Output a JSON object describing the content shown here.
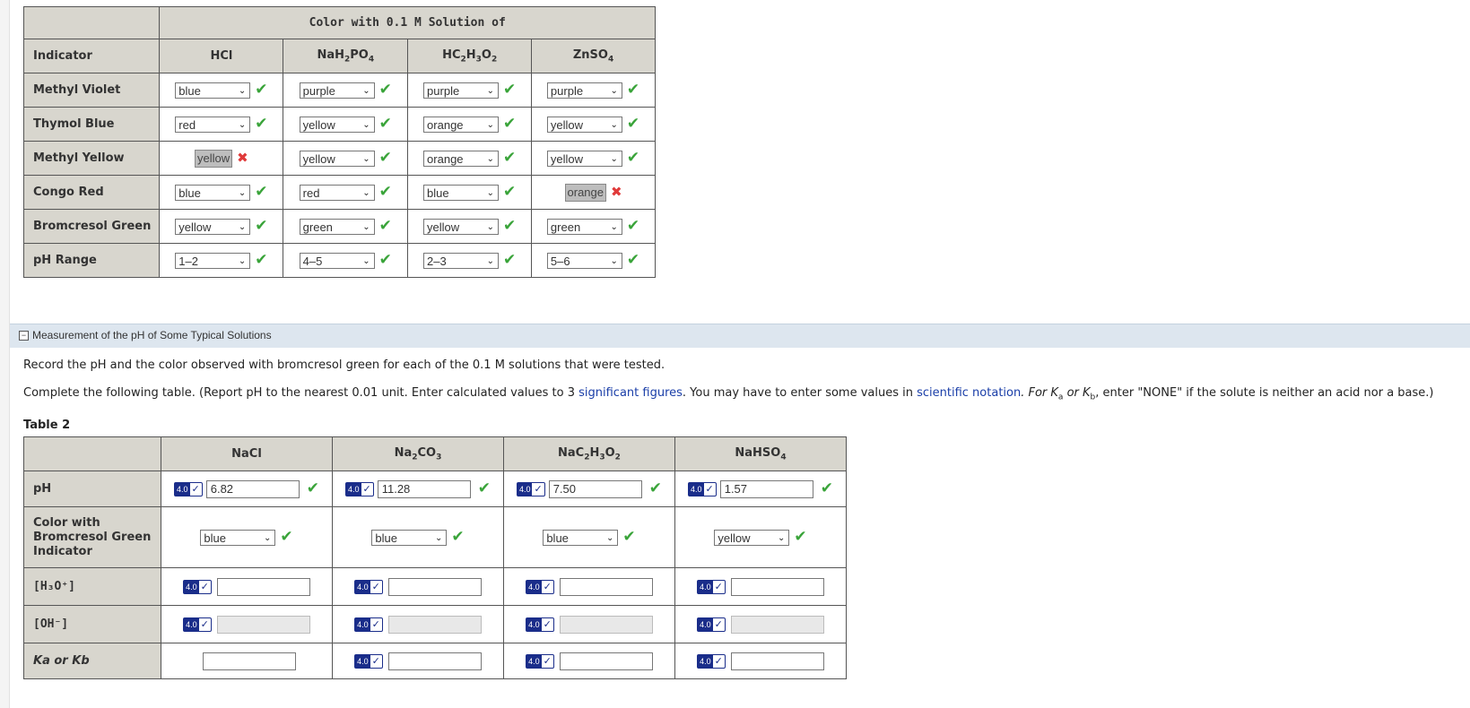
{
  "table1": {
    "header_title": "Color with 0.1 M Solution of",
    "indicator_label": "Indicator",
    "columns": [
      {
        "base": "HCl"
      },
      {
        "base": "NaH",
        "sub1": "2",
        "mid": "PO",
        "sub2": "4"
      },
      {
        "base": "HC",
        "sub1": "2",
        "mid": "H",
        "sub2": "3",
        "end": "O",
        "sub3": "2"
      },
      {
        "base": "ZnSO",
        "sub1": "4"
      }
    ],
    "rows": [
      {
        "label": "Methyl Violet",
        "cells": [
          {
            "value": "blue",
            "status": "correct",
            "type": "select"
          },
          {
            "value": "purple",
            "status": "correct",
            "type": "select"
          },
          {
            "value": "purple",
            "status": "correct",
            "type": "select"
          },
          {
            "value": "purple",
            "status": "correct",
            "type": "select"
          }
        ]
      },
      {
        "label": "Thymol Blue",
        "cells": [
          {
            "value": "red",
            "status": "correct",
            "type": "select"
          },
          {
            "value": "yellow",
            "status": "correct",
            "type": "select"
          },
          {
            "value": "orange",
            "status": "correct",
            "type": "select"
          },
          {
            "value": "yellow",
            "status": "correct",
            "type": "select"
          }
        ]
      },
      {
        "label": "Methyl Yellow",
        "cells": [
          {
            "value": "yellow",
            "status": "incorrect",
            "type": "answered"
          },
          {
            "value": "yellow",
            "status": "correct",
            "type": "select"
          },
          {
            "value": "orange",
            "status": "correct",
            "type": "select"
          },
          {
            "value": "yellow",
            "status": "correct",
            "type": "select"
          }
        ]
      },
      {
        "label": "Congo Red",
        "cells": [
          {
            "value": "blue",
            "status": "correct",
            "type": "select"
          },
          {
            "value": "red",
            "status": "correct",
            "type": "select"
          },
          {
            "value": "blue",
            "status": "correct",
            "type": "select"
          },
          {
            "value": "orange",
            "status": "incorrect",
            "type": "answered"
          }
        ]
      },
      {
        "label": "Bromcresol Green",
        "cells": [
          {
            "value": "yellow",
            "status": "correct",
            "type": "select"
          },
          {
            "value": "green",
            "status": "correct",
            "type": "select"
          },
          {
            "value": "yellow",
            "status": "correct",
            "type": "select"
          },
          {
            "value": "green",
            "status": "correct",
            "type": "select"
          }
        ]
      },
      {
        "label": "pH Range",
        "cells": [
          {
            "value": "1–2",
            "status": "correct",
            "type": "select"
          },
          {
            "value": "4–5",
            "status": "correct",
            "type": "select"
          },
          {
            "value": "2–3",
            "status": "correct",
            "type": "select"
          },
          {
            "value": "5–6",
            "status": "correct",
            "type": "select"
          }
        ]
      }
    ]
  },
  "section": {
    "title": "Measurement of the pH of Some Typical Solutions",
    "para1": "Record the pH and the color observed with bromcresol green for each of the 0.1 M solutions that were tested.",
    "para2_start": "Complete the following table. (Report pH to the nearest 0.01 unit. Enter calculated values to 3 ",
    "link1": "significant figures",
    "para2_mid": ". You may have to enter some values in ",
    "link2": "scientific notation",
    "para2_end": ". For K",
    "para2_a": "a",
    "para2_or": " or K",
    "para2_b": "b",
    "para2_tail": ", enter \"NONE\" if the solute is neither an acid nor a base.)",
    "table_caption": "Table 2"
  },
  "table2": {
    "columns": [
      {
        "base": "NaCl"
      },
      {
        "base": "Na",
        "sub1": "2",
        "mid": "CO",
        "sub2": "3"
      },
      {
        "base": "NaC",
        "sub1": "2",
        "mid": "H",
        "sub2": "3",
        "end": "O",
        "sub3": "2"
      },
      {
        "base": "NaHSO",
        "sub1": "4"
      }
    ],
    "badge_num": "4.0",
    "badge_tick": "✓",
    "ph_label": "pH",
    "ph_values": [
      "6.82",
      "11.28",
      "7.50",
      "1.57"
    ],
    "color_label": "Color with Bromcresol Green Indicator",
    "color_values": [
      "blue",
      "blue",
      "blue",
      "yellow"
    ],
    "h3o_label": "[H₃O⁺]",
    "oh_label": "[OH⁻]",
    "ka_label": "Ka or Kb"
  },
  "colors": {
    "header_bg": "#d8d6ce",
    "check": "#3aa43a",
    "cross": "#e03a3a",
    "badge": "#1a2d8a",
    "section_bg": "#dde6ef"
  }
}
